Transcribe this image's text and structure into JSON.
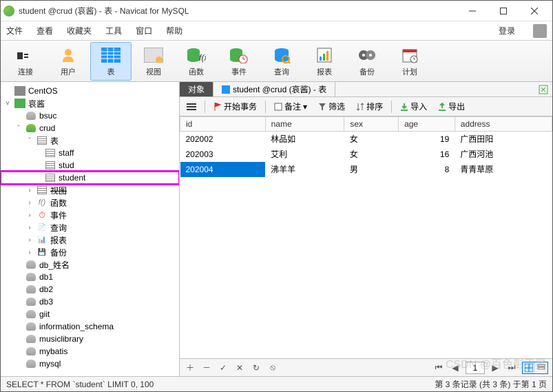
{
  "window": {
    "title": "student @crud (哀酱) - 表 - Navicat for MySQL"
  },
  "menu": {
    "file": "文件",
    "view": "查看",
    "favorites": "收藏夹",
    "tools": "工具",
    "window": "窗口",
    "help": "帮助",
    "login": "登录"
  },
  "ribbon": {
    "connection": "连接",
    "user": "用户",
    "table": "表",
    "viewbtn": "视图",
    "function": "函数",
    "event": "事件",
    "query": "查询",
    "report": "报表",
    "backup": "备份",
    "plan": "计划"
  },
  "tree": {
    "centos": "CentOS",
    "aijang": "哀酱",
    "bsuc": "bsuc",
    "crud": "crud",
    "tables_label": "表",
    "staff": "staff",
    "stud": "stud",
    "student": "student",
    "views_label": "视图",
    "funcs": "函数",
    "events": "事件",
    "queries": "查询",
    "reports": "报表",
    "backups": "备份",
    "db_name": "db_姓名",
    "db1": "db1",
    "db2": "db2",
    "db3": "db3",
    "giit": "giit",
    "info_schema": "information_schema",
    "musiclib": "musiclibrary",
    "mybatis": "mybatis",
    "mysql": "mysql"
  },
  "tabs": {
    "objects": "对象",
    "student_tab": "student @crud (哀酱) - 表"
  },
  "subToolbar": {
    "begin_txn": "开始事务",
    "memo": "备注",
    "filter": "筛选",
    "sort": "排序",
    "import": "导入",
    "export": "导出"
  },
  "columns": {
    "id": "id",
    "name": "name",
    "sex": "sex",
    "age": "age",
    "address": "address"
  },
  "rows": [
    {
      "id": "202002",
      "name": "林品如",
      "sex": "女",
      "age": "19",
      "address": "广西田阳"
    },
    {
      "id": "202003",
      "name": "艾利",
      "sex": "女",
      "age": "16",
      "address": "广西河池"
    },
    {
      "id": "202004",
      "name": "沸羊羊",
      "sex": "男",
      "age": "8",
      "address": "青青草原"
    }
  ],
  "page_input": "1",
  "status": {
    "sql": "SELECT * FROM `student` LIMIT 0, 100",
    "records": "第 3 条记录 (共 3 条) 于第 1 页"
  },
  "watermark": "CSDN @百色彭于晏"
}
